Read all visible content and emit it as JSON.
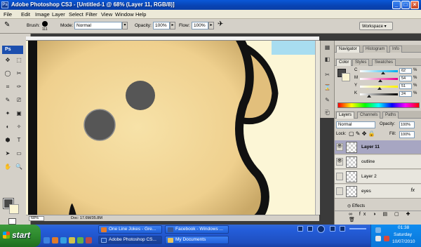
{
  "window": {
    "app_logo_text": "Ps",
    "title": "Adobe Photoshop CS3 - [Untitled-1 @ 68% (Layer 11, RGB/8)]",
    "minimize": "_",
    "maximize": "□",
    "close": "×"
  },
  "menu": [
    "File",
    "Edit",
    "Image",
    "Layer",
    "Select",
    "Filter",
    "View",
    "Window",
    "Help"
  ],
  "options": {
    "brush_label": "Brush:",
    "brush_size": "111",
    "mode_label": "Mode:",
    "mode_value": "Normal",
    "opacity_label": "Opacity:",
    "opacity_value": "100%",
    "flow_label": "Flow:",
    "flow_value": "100%",
    "workspace_label": "Workspace ▾"
  },
  "tools": {
    "badge": "Ps",
    "glyphs": [
      "✥",
      "⬚",
      "◯",
      "✂",
      "⌗",
      "✑",
      "✎",
      "⎚",
      "✦",
      "▣",
      "◐",
      "✧",
      "⬢",
      "T",
      "➤",
      "▭",
      "✋",
      "🔍"
    ]
  },
  "canvas": {
    "zoom": "68%",
    "doc_info": "Doc: 17.6M/35.8M",
    "colors": {
      "body": "#f1d796",
      "cream": "#fcf6d6",
      "outline": "#111111",
      "eyes": "#565656",
      "sky": "#a8ddf0"
    }
  },
  "panels": {
    "nav_tabs": [
      "Navigator",
      "Histogram",
      "Info"
    ],
    "color_tabs": [
      "Color",
      "Styles",
      "Swatches"
    ],
    "cmyk": [
      {
        "ch": "C",
        "value": "62",
        "pos": 0.62,
        "grad": "linear-gradient(90deg,#fff,#00aeef)"
      },
      {
        "ch": "M",
        "value": "54",
        "pos": 0.54,
        "grad": "linear-gradient(90deg,#fff,#ec008c)"
      },
      {
        "ch": "Y",
        "value": "51",
        "pos": 0.51,
        "grad": "linear-gradient(90deg,#fff,#fff200)"
      },
      {
        "ch": "K",
        "value": "24",
        "pos": 0.24,
        "grad": "linear-gradient(90deg,#fff,#000)"
      }
    ],
    "pct": "%",
    "layers_tabs": [
      "Layers",
      "Channels",
      "Paths"
    ],
    "blend_mode": "Normal",
    "opacity_label": "Opacity:",
    "opacity_value": "100%",
    "lock_label": "Lock:",
    "fill_label": "Fill:",
    "fill_value": "100%",
    "layers": [
      {
        "name": "Layer 11",
        "visible": true,
        "selected": true
      },
      {
        "name": "outline",
        "visible": true,
        "selected": false
      },
      {
        "name": "Layer 2",
        "visible": false,
        "selected": false
      },
      {
        "name": "eyes",
        "visible": false,
        "selected": false,
        "fx": "fx"
      }
    ],
    "effects_label": "Effects"
  },
  "taskbar": {
    "start_label": "start",
    "tasks": [
      {
        "label": "One Line Jokes - Gre...",
        "active": false,
        "color": "#e57b2a"
      },
      {
        "label": "Facebook - Windows ...",
        "active": false,
        "color": "#3b5998"
      },
      {
        "label": "Adobe Photoshop CS...",
        "active": true,
        "color": "#1c4fae"
      },
      {
        "label": "My Documents",
        "active": false,
        "color": "#e9c45a"
      }
    ],
    "time": "01:38",
    "day": "Saturday",
    "date": "10/07/2010"
  }
}
